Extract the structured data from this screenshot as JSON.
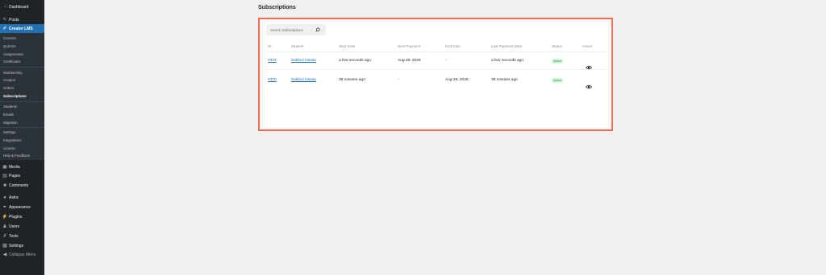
{
  "sidebar": {
    "dashboard": "Dashboard",
    "posts": "Posts",
    "creator_lms": "Creator LMS",
    "sub_group1": [
      "Courses",
      "Quizzes",
      "Assignments",
      "Certificates"
    ],
    "sub_group2": [
      "Membership",
      "Coupon",
      "Orders",
      "Subscriptions"
    ],
    "sub_group3": [
      "Students",
      "Emails",
      "Migration"
    ],
    "sub_group4": [
      "Settings",
      "Integrations",
      "License",
      "Help & Feedback"
    ],
    "media": "Media",
    "pages": "Pages",
    "comments": "Comments",
    "astra": "Astra",
    "appearance": "Appearance",
    "plugins": "Plugins",
    "users": "Users",
    "tools": "Tools",
    "settings": "Settings",
    "collapse": "Collapse Menu"
  },
  "page_title": "Subscriptions",
  "search": {
    "placeholder": "Search Subscriptions"
  },
  "table": {
    "headers": [
      "ID",
      "Student",
      "Start Date",
      "Next Payment",
      "End Date",
      "Last Payment Date",
      "Status",
      "Action"
    ],
    "rows": [
      {
        "id": "#372",
        "student": "Sakibul Hasan",
        "start_date": "a few seconds ago",
        "next_payment": "Aug 29, 2026",
        "end_date": "-",
        "last_payment": "a few seconds ago",
        "status": "Active"
      },
      {
        "id": "#370",
        "student": "Sakibul Hasan",
        "start_date": "38 minutes ago",
        "next_payment": "-",
        "end_date": "Aug 29, 2026",
        "last_payment": "38 minutes ago",
        "status": "Active"
      }
    ]
  },
  "colors": {
    "accent": "#2271b1",
    "highlight": "#f26b55",
    "active_badge": "#00a32a",
    "sidebar": "#1d2327"
  },
  "icons": [
    "dashboard-icon",
    "posts-icon",
    "creator-lms-icon",
    "media-icon",
    "pages-icon",
    "comments-icon",
    "astra-icon",
    "appearance-icon",
    "plugins-icon",
    "users-icon",
    "tools-icon",
    "settings-icon",
    "collapse-icon",
    "search-icon",
    "eye-icon"
  ]
}
